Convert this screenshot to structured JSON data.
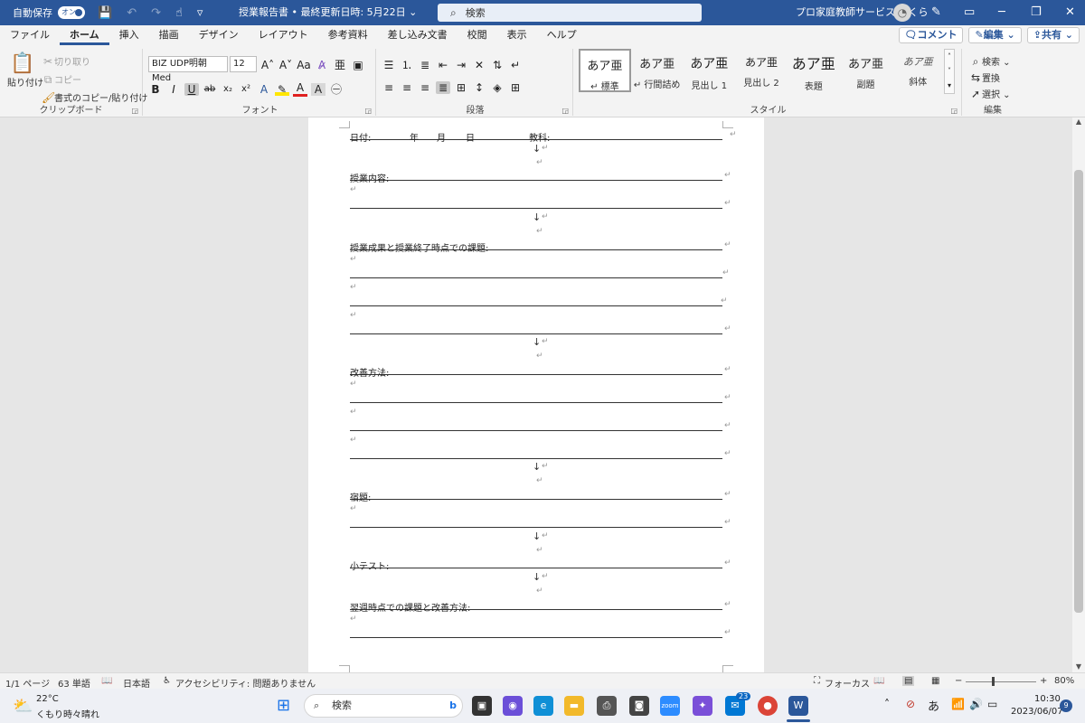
{
  "titlebar": {
    "autosave_label": "自動保存",
    "autosave_state": "オン",
    "doc_title": "授業報告書 • 最終更新日時: 5月22日 ⌄",
    "search_placeholder": "検索",
    "user_name": "プロ家庭教師サービス さくら"
  },
  "tabs": [
    "ファイル",
    "ホーム",
    "挿入",
    "描画",
    "デザイン",
    "レイアウト",
    "参考資料",
    "差し込み文書",
    "校閲",
    "表示",
    "ヘルプ"
  ],
  "tab_actions": {
    "comment": "コメント",
    "edit": "編集 ⌄",
    "share": "共有 ⌄"
  },
  "ribbon": {
    "clipboard": {
      "paste": "貼り付け",
      "cut": "切り取り",
      "copy": "コピー",
      "format_painter": "書式のコピー/貼り付け",
      "label": "クリップボード"
    },
    "font": {
      "name": "BIZ UDP明朝 Med",
      "size": "12",
      "label": "フォント"
    },
    "paragraph": {
      "label": "段落"
    },
    "styles": {
      "label": "スタイル",
      "items": [
        {
          "sample": "あア亜",
          "name": "↵ 標準"
        },
        {
          "sample": "あア亜",
          "name": "↵ 行間詰め"
        },
        {
          "sample": "あア亜",
          "name": "見出し 1"
        },
        {
          "sample": "あア亜",
          "name": "見出し 2"
        },
        {
          "sample": "あア亜",
          "name": "表題"
        },
        {
          "sample": "あア亜",
          "name": "副題"
        },
        {
          "sample": "あア亜",
          "name": "斜体"
        }
      ]
    },
    "editing": {
      "find": "検索",
      "replace": "置換",
      "select": "選択",
      "label": "編集"
    }
  },
  "document": {
    "date_line": {
      "date": "日付:",
      "year": "年",
      "month": "月",
      "day": "日",
      "subject": "教科:"
    },
    "sections": {
      "content": "授業内容:",
      "results": "授業成果と授業終了時点での課題:",
      "improve": "改善方法:",
      "homework": "宿題:",
      "quiz": "小テスト:",
      "next_week": "翌週時点での課題と改善方法:"
    },
    "return_mark": "↵",
    "down_arrow": "↓"
  },
  "statusbar": {
    "page": "1/1 ページ",
    "words": "63 単語",
    "language": "日本語",
    "accessibility": "アクセシビリティ: 問題ありません",
    "focus": "フォーカス",
    "zoom": "80%"
  },
  "taskbar": {
    "weather_temp": "22°C",
    "weather_desc": "くもり時々晴れ",
    "search": "検索",
    "ime": "あ",
    "time": "10:30",
    "date": "2023/06/07",
    "badge": "23",
    "notif": "9"
  }
}
